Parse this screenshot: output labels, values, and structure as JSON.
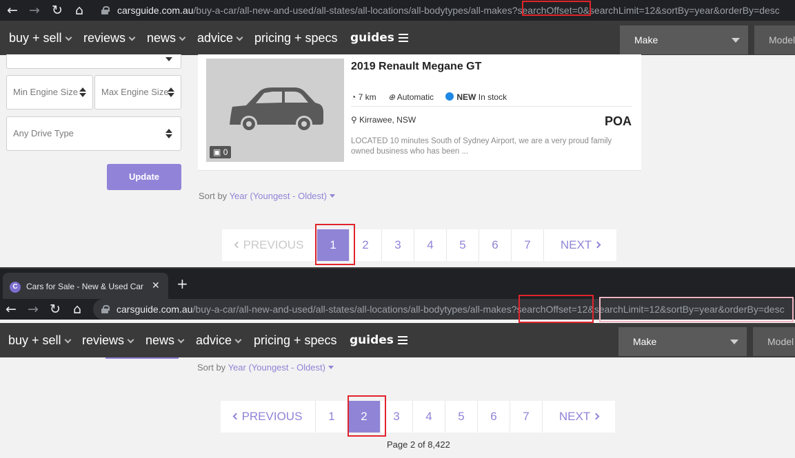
{
  "shot1": {
    "url": {
      "host": "carsguide.com.au",
      "path": "/buy-a-car/all-new-and-used/all-states/all-locations/all-bodytypes/all-makes?",
      "offset": "searchOffset=0",
      "rest": "&searchLimit=12&sortBy=year&orderBy=desc"
    },
    "nav": {
      "buy_sell": "buy + sell",
      "reviews": "reviews",
      "news": "news",
      "advice": "advice",
      "pricing": "pricing + specs",
      "guides": "guides",
      "make": "Make",
      "model": "Model"
    },
    "filters": {
      "min_engine": "Min Engine Size",
      "max_engine": "Max Engine Size",
      "drive_type": "Any Drive Type",
      "update": "Update"
    },
    "listing": {
      "title": "2019 Renault Megane GT",
      "photo_count": "0",
      "km": "7 km",
      "transmission": "Automatic",
      "badge_new": "NEW",
      "badge_stock": "In stock",
      "location": "Kirrawee, NSW",
      "price": "POA",
      "description": "LOCATED 10 minutes South of Sydney Airport, we are a very proud family owned business who has been ..."
    },
    "sort": {
      "label": "Sort by",
      "value": "Year (Youngest - Oldest)"
    },
    "pager": {
      "prev": "PREVIOUS",
      "next": "NEXT",
      "pages": [
        "1",
        "2",
        "3",
        "4",
        "5",
        "6",
        "7"
      ],
      "active": 1
    }
  },
  "shot2": {
    "tab_title": "Cars for Sale - New & Used Car S",
    "favicon": "C",
    "url": {
      "host": "carsguide.com.au",
      "path": "/buy-a-car/all-new-and-used/all-states/all-locations/all-bodytypes/all-makes?",
      "offset": "searchOffset=12",
      "rest": "&searchLimit=12&sortBy=year&orderBy=desc"
    },
    "nav": {
      "buy_sell": "buy + sell",
      "reviews": "reviews",
      "news": "news",
      "advice": "advice",
      "pricing": "pricing + specs",
      "guides": "guides",
      "make": "Make",
      "model": "Model"
    },
    "sort": {
      "label": "Sort by",
      "value": "Year (Youngest - Oldest)"
    },
    "pager": {
      "prev": "PREVIOUS",
      "next": "NEXT",
      "pages": [
        "1",
        "2",
        "3",
        "4",
        "5",
        "6",
        "7"
      ],
      "active": 2
    },
    "page_info": "Page 2 of 8,422"
  },
  "colors": {
    "accent": "#8f84d6",
    "highlight_red": "#e0242b",
    "highlight_pink": "#f4b6c2",
    "nav_bg": "#3a3a3a"
  },
  "icons": [
    "back-arrow-icon",
    "forward-arrow-icon",
    "reload-icon",
    "home-icon",
    "lock-icon",
    "chevron-down-icon",
    "menu-icon",
    "camera-icon",
    "speedometer-icon",
    "gearbox-icon",
    "map-pin-icon",
    "close-icon",
    "plus-icon"
  ]
}
